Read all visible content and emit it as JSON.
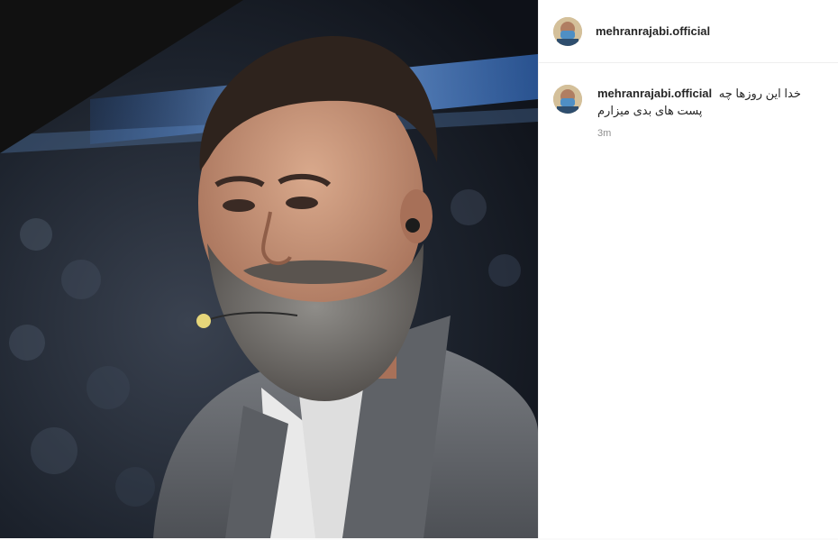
{
  "post": {
    "image_icon": "portrait-photo",
    "header": {
      "username": "mehranrajabi.official",
      "avatar_icon": "profile-avatar"
    },
    "caption": {
      "username": "mehranrajabi.official",
      "text": "خدا این روزها چه پست های بدی میزارم",
      "time": "3m"
    }
  },
  "colors": {
    "text": "#262626",
    "muted": "#8e8e8e",
    "border": "#efefef",
    "mourning_ribbon": "#111111"
  }
}
